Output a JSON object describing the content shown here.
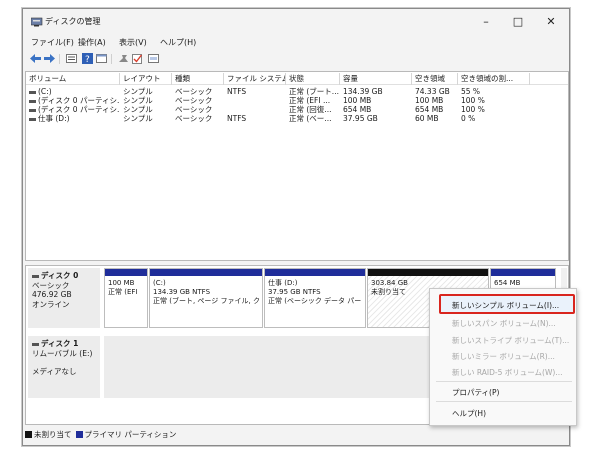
{
  "window": {
    "title": "ディスクの管理",
    "controls": {
      "minimize": "–",
      "maximize": "□",
      "close": "✕"
    }
  },
  "menu": [
    "ファイル(F)",
    "操作(A)",
    "表示(V)",
    "ヘルプ(H)"
  ],
  "toolbar_icons": [
    "back-arrow-icon",
    "forward-arrow-icon",
    "list-view-icon",
    "help-icon",
    "console-icon",
    "pin-icon",
    "check-icon",
    "properties-icon"
  ],
  "volume_table": {
    "headers": [
      "ボリューム",
      "レイアウト",
      "種類",
      "ファイル システム",
      "状態",
      "容量",
      "空き領域",
      "空き領域の割..."
    ],
    "rows": [
      [
        "(C:)",
        "シンプル",
        "ベーシック",
        "NTFS",
        "正常 (ブート...",
        "134.39 GB",
        "74.33 GB",
        "55 %"
      ],
      [
        "(ディスク 0 パーティシ...",
        "シンプル",
        "ベーシック",
        "",
        "正常 (EFI ...",
        "100 MB",
        "100 MB",
        "100 %"
      ],
      [
        "(ディスク 0 パーティシ...",
        "シンプル",
        "ベーシック",
        "",
        "正常 (回復...",
        "654 MB",
        "654 MB",
        "100 %"
      ],
      [
        "仕事 (D:)",
        "シンプル",
        "ベーシック",
        "NTFS",
        "正常 (ベー...",
        "37.95 GB",
        "60 MB",
        "0 %"
      ]
    ]
  },
  "disk0": {
    "title": "ディスク 0",
    "type": "ベーシック",
    "size": "476.92 GB",
    "status": "オンライン",
    "partitions": [
      {
        "line1": "",
        "line2": "100 MB",
        "line3": "正常 (EFI"
      },
      {
        "line1": "(C:)",
        "line2": "134.39 GB NTFS",
        "line3": "正常 (ブート, ページ ファイル, ク"
      },
      {
        "line1": "仕事 (D:)",
        "line2": "37.95 GB NTFS",
        "line3": "正常 (ベーシック データ パー"
      },
      {
        "line1": "",
        "line2": "303.84 GB",
        "line3": "未割り当て"
      },
      {
        "line1": "",
        "line2": "654 MB",
        "line3": ""
      }
    ]
  },
  "disk1": {
    "title": "ディスク 1",
    "type": "リムーバブル (E:)",
    "status": "メディアなし"
  },
  "legend": {
    "unallocated": "未割り当て",
    "primary": "プライマリ パーティション",
    "unallocated_color": "#111111",
    "primary_color": "#1f2d9a"
  },
  "context_menu": {
    "items": [
      {
        "label": "新しいシンプル ボリューム(I)...",
        "enabled": true,
        "highlighted": true
      },
      {
        "label": "新しいスパン ボリューム(N)...",
        "enabled": false
      },
      {
        "label": "新しいストライプ ボリューム(T)...",
        "enabled": false
      },
      {
        "label": "新しいミラー ボリューム(R)...",
        "enabled": false
      },
      {
        "label": "新しい RAID-5 ボリューム(W)...",
        "enabled": false
      },
      {
        "label": "プロパティ(P)",
        "enabled": true
      },
      {
        "label": "ヘルプ(H)",
        "enabled": true
      }
    ],
    "highlight_color": "#d9251e"
  }
}
